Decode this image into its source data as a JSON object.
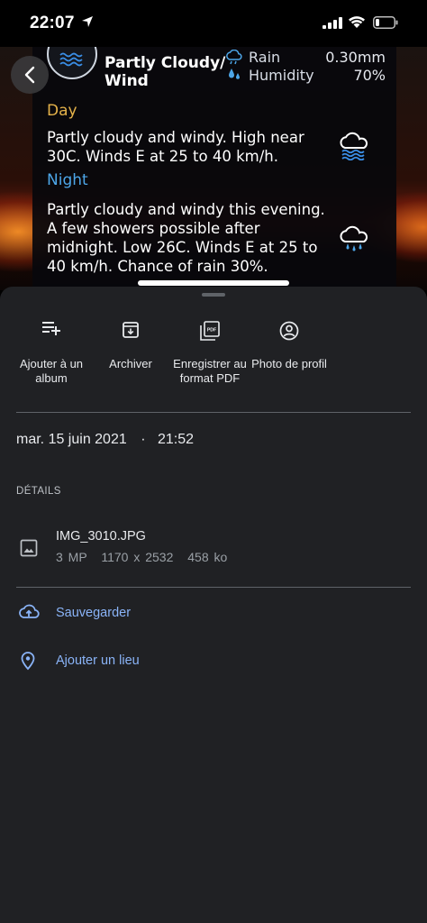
{
  "status_bar": {
    "time": "22:07"
  },
  "weather": {
    "condition_line1": "Partly Cloudy/",
    "condition_line2": "Wind",
    "rain_label": "Rain",
    "rain_value": "0.30mm",
    "humidity_label": "Humidity",
    "humidity_value": "70%",
    "day_heading": "Day",
    "day_text": "Partly cloudy and windy. High near 30C. Winds E at 25 to 40 km/h.",
    "night_heading": "Night",
    "night_text": "Partly cloudy and windy this evening. A few showers possible after midnight. Low 26C. Winds E at 25 to 40 km/h. Chance of rain 30%."
  },
  "actions": [
    {
      "label": "Ajouter à un album",
      "icon": "playlist-add-icon"
    },
    {
      "label": "Archiver",
      "icon": "archive-icon"
    },
    {
      "label": "Enregistrer au format PDF",
      "icon": "pdf-icon"
    },
    {
      "label": "Photo de profil",
      "icon": "account-circle-icon"
    }
  ],
  "date": {
    "day": "mar. 15 juin 2021",
    "separator": "·",
    "time": "21:52"
  },
  "details": {
    "heading": "DÉTAILS",
    "file_name": "IMG_3010.JPG",
    "megapixels": "3 MP",
    "dimensions": "1170 x 2532",
    "size": "458 ko"
  },
  "links": {
    "backup": "Sauvegarder",
    "add_location": "Ajouter un lieu"
  },
  "colors": {
    "sheet": "#202124",
    "link": "#8ab4f8",
    "day_heading": "#e4b24a",
    "night_heading": "#4da6e8"
  }
}
